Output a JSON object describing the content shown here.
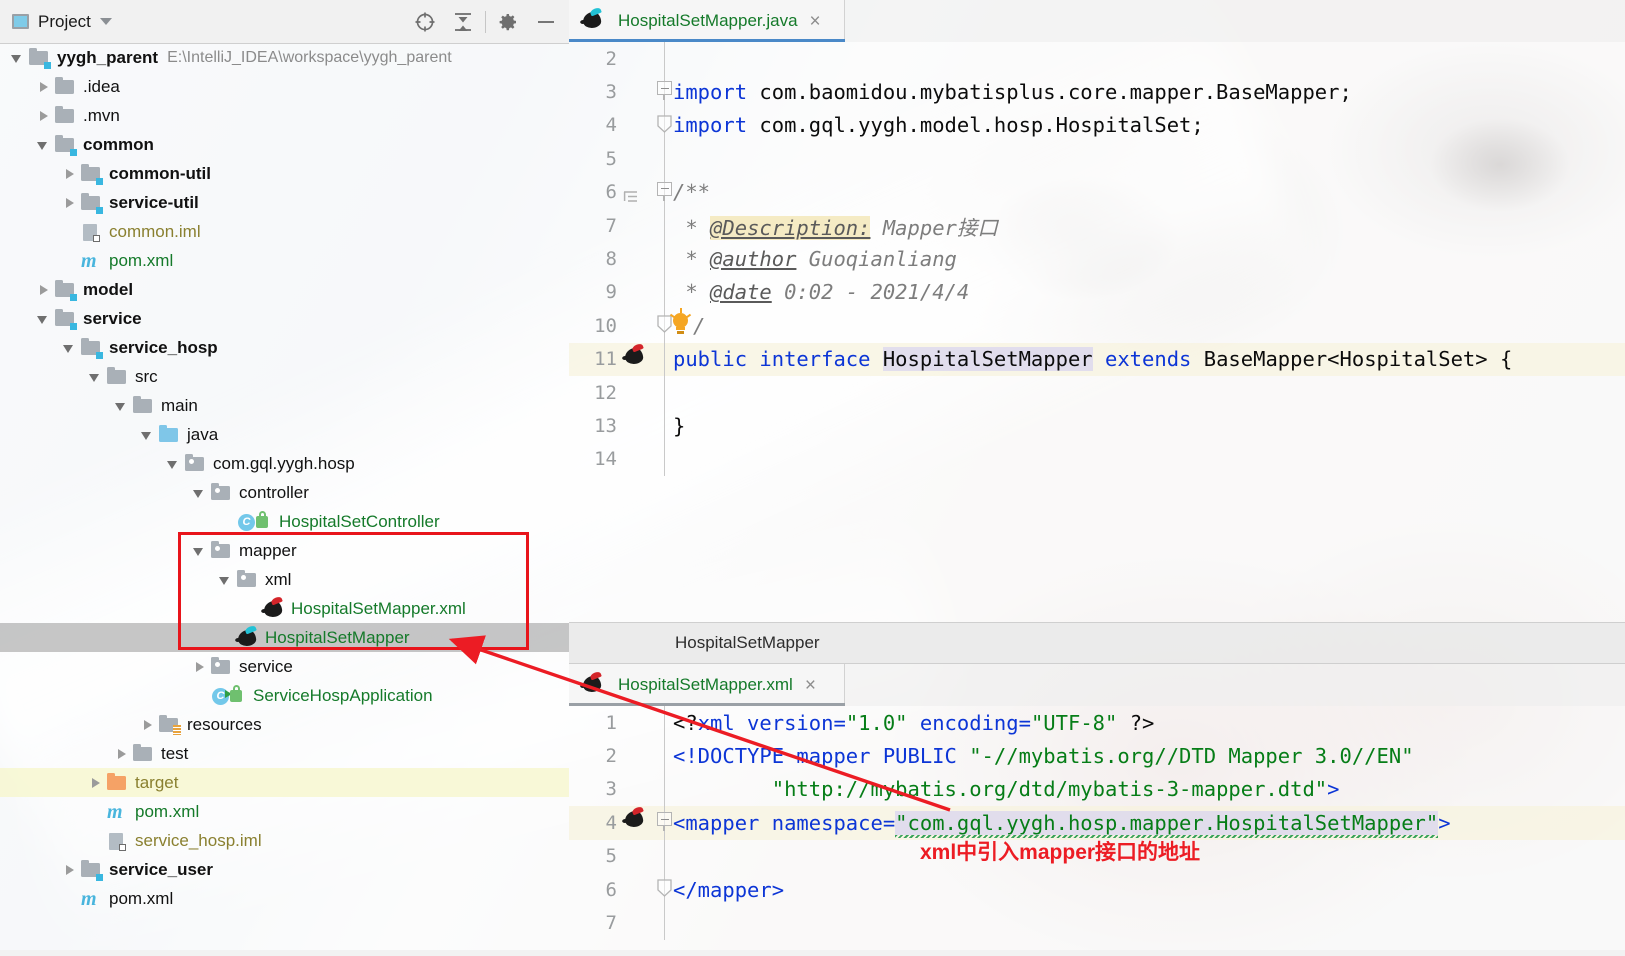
{
  "project_panel": {
    "title": "Project",
    "toolbar": [
      {
        "name": "locate-icon",
        "label": "Select Opened File"
      },
      {
        "name": "collapse-all-icon",
        "label": "Collapse All"
      },
      {
        "name": "gear-icon",
        "label": "Settings"
      },
      {
        "name": "minimize-icon",
        "label": "Hide"
      }
    ],
    "tree": [
      {
        "depth": 0,
        "arrow": "open",
        "icon": "module-folder",
        "label": "yygh_parent",
        "bold": true,
        "color": "dark",
        "sub": "E:\\IntelliJ_IDEA\\workspace\\yygh_parent"
      },
      {
        "depth": 1,
        "arrow": "closed",
        "icon": "folder-grey",
        "label": ".idea",
        "bold": false,
        "color": "dark"
      },
      {
        "depth": 1,
        "arrow": "closed",
        "icon": "folder-grey",
        "label": ".mvn",
        "bold": false,
        "color": "dark"
      },
      {
        "depth": 1,
        "arrow": "open",
        "icon": "module-folder",
        "label": "common",
        "bold": true,
        "color": "dark"
      },
      {
        "depth": 2,
        "arrow": "closed",
        "icon": "module-folder",
        "label": "common-util",
        "bold": true,
        "color": "dark"
      },
      {
        "depth": 2,
        "arrow": "closed",
        "icon": "module-folder",
        "label": "service-util",
        "bold": true,
        "color": "dark"
      },
      {
        "depth": 2,
        "arrow": "none",
        "icon": "iml-file",
        "label": "common.iml",
        "bold": false,
        "color": "olive"
      },
      {
        "depth": 2,
        "arrow": "none",
        "icon": "maven-file",
        "label": "pom.xml",
        "bold": false,
        "color": "green"
      },
      {
        "depth": 1,
        "arrow": "closed",
        "icon": "module-folder",
        "label": "model",
        "bold": true,
        "color": "dark"
      },
      {
        "depth": 1,
        "arrow": "open",
        "icon": "module-folder",
        "label": "service",
        "bold": true,
        "color": "dark"
      },
      {
        "depth": 2,
        "arrow": "open",
        "icon": "module-folder",
        "label": "service_hosp",
        "bold": true,
        "color": "dark"
      },
      {
        "depth": 3,
        "arrow": "open",
        "icon": "folder-grey",
        "label": "src",
        "bold": false,
        "color": "dark"
      },
      {
        "depth": 4,
        "arrow": "open",
        "icon": "folder-grey",
        "label": "main",
        "bold": false,
        "color": "dark"
      },
      {
        "depth": 5,
        "arrow": "open",
        "icon": "folder-blue",
        "label": "java",
        "bold": false,
        "color": "dark"
      },
      {
        "depth": 6,
        "arrow": "open",
        "icon": "package",
        "label": "com.gql.yygh.hosp",
        "bold": false,
        "color": "dark"
      },
      {
        "depth": 7,
        "arrow": "open",
        "icon": "package",
        "label": "controller",
        "bold": false,
        "color": "dark"
      },
      {
        "depth": 8,
        "arrow": "none",
        "icon": "java-class-lock",
        "label": "HospitalSetController",
        "bold": false,
        "color": "green"
      },
      {
        "depth": 7,
        "arrow": "open",
        "icon": "package",
        "label": "mapper",
        "bold": false,
        "color": "dark"
      },
      {
        "depth": 8,
        "arrow": "open",
        "icon": "package",
        "label": "xml",
        "bold": false,
        "color": "dark"
      },
      {
        "depth": 9,
        "arrow": "none",
        "icon": "mybatis-xml",
        "label": "HospitalSetMapper.xml",
        "bold": false,
        "color": "green"
      },
      {
        "depth": 8,
        "arrow": "none",
        "icon": "mybatis-iface",
        "label": "HospitalSetMapper",
        "bold": false,
        "color": "green",
        "selected": true
      },
      {
        "depth": 7,
        "arrow": "closed",
        "icon": "package",
        "label": "service",
        "bold": false,
        "color": "dark"
      },
      {
        "depth": 7,
        "arrow": "none",
        "icon": "spring-boot-class",
        "label": "ServiceHospApplication",
        "bold": false,
        "color": "green"
      },
      {
        "depth": 5,
        "arrow": "closed",
        "icon": "resources-folder",
        "label": "resources",
        "bold": false,
        "color": "dark"
      },
      {
        "depth": 4,
        "arrow": "closed",
        "icon": "folder-grey",
        "label": "test",
        "bold": false,
        "color": "dark"
      },
      {
        "depth": 3,
        "arrow": "closed",
        "icon": "folder-orange",
        "label": "target",
        "bold": false,
        "color": "olive",
        "highlight": true
      },
      {
        "depth": 3,
        "arrow": "none",
        "icon": "maven-file",
        "label": "pom.xml",
        "bold": false,
        "color": "green"
      },
      {
        "depth": 3,
        "arrow": "none",
        "icon": "iml-file",
        "label": "service_hosp.iml",
        "bold": false,
        "color": "olive"
      },
      {
        "depth": 2,
        "arrow": "closed",
        "icon": "module-folder",
        "label": "service_user",
        "bold": true,
        "color": "dark"
      },
      {
        "depth": 2,
        "arrow": "none",
        "icon": "maven-file",
        "label": "pom.xml",
        "bold": false,
        "color": "dark"
      }
    ]
  },
  "annotation": {
    "box_color": "#e8141b",
    "arrow_color": "#ec1c24",
    "note": "xml中引入mapper接口的地址"
  },
  "top_editor": {
    "tab": {
      "icon": "mybatis-iface-icon",
      "label": "HospitalSetMapper.java",
      "close": "×"
    },
    "lines": [
      {
        "num": "2",
        "segments": []
      },
      {
        "num": "3",
        "fold": "start",
        "segments": [
          {
            "t": "import ",
            "c": "kw"
          },
          {
            "t": "com.baomidou.mybatisplus.core.mapper.BaseMapper;",
            "c": "plain"
          }
        ]
      },
      {
        "num": "4",
        "fold": "end",
        "segments": [
          {
            "t": "import ",
            "c": "kw"
          },
          {
            "t": "com.gql.yygh.model.hosp.HospitalSet;",
            "c": "plain"
          }
        ]
      },
      {
        "num": "5",
        "segments": []
      },
      {
        "num": "6",
        "fold": "start",
        "indentguide": true,
        "segments": [
          {
            "t": "/**",
            "c": "cmt"
          }
        ]
      },
      {
        "num": "7",
        "segments": [
          {
            "t": " * ",
            "c": "cmt"
          },
          {
            "t": "@Description:",
            "c": "cmt-tag hl-doc"
          },
          {
            "t": " Mapper接口",
            "c": "cmt"
          }
        ]
      },
      {
        "num": "8",
        "segments": [
          {
            "t": " * ",
            "c": "cmt"
          },
          {
            "t": "@author",
            "c": "cmt-tag"
          },
          {
            "t": " Guoqianliang",
            "c": "cmt"
          }
        ]
      },
      {
        "num": "9",
        "segments": [
          {
            "t": " * ",
            "c": "cmt"
          },
          {
            "t": "@date",
            "c": "cmt-tag"
          },
          {
            "t": " 0:02 - 2021/4/4",
            "c": "cmt"
          }
        ]
      },
      {
        "num": "10",
        "fold": "end",
        "bulb": true,
        "segments": [
          {
            "t": "/",
            "c": "cmt"
          }
        ]
      },
      {
        "num": "11",
        "gutter_icon": "mybatis-bird",
        "highlight": true,
        "segments": [
          {
            "t": "public ",
            "c": "kw"
          },
          {
            "t": "interface ",
            "c": "kw"
          },
          {
            "t": "HospitalSetMapper",
            "c": "plain ident-hl"
          },
          {
            "t": " extends ",
            "c": "kw"
          },
          {
            "t": "BaseMapper<HospitalSet> {",
            "c": "plain"
          }
        ]
      },
      {
        "num": "12",
        "segments": []
      },
      {
        "num": "13",
        "segments": [
          {
            "t": "}",
            "c": "plain"
          }
        ]
      },
      {
        "num": "14",
        "segments": []
      }
    ]
  },
  "breadcrumb": {
    "label": "HospitalSetMapper"
  },
  "bottom_editor": {
    "tab": {
      "icon": "mybatis-xml-icon",
      "label": "HospitalSetMapper.xml",
      "close": "×"
    },
    "lines": [
      {
        "num": "1",
        "segments": [
          {
            "t": "<?",
            "c": "plain"
          },
          {
            "t": "xml",
            "c": "xtag"
          },
          {
            "t": " version=",
            "c": "xtag"
          },
          {
            "t": "\"1.0\"",
            "c": "str"
          },
          {
            "t": " encoding=",
            "c": "xtag"
          },
          {
            "t": "\"UTF-8\"",
            "c": "str"
          },
          {
            "t": " ?>",
            "c": "plain"
          }
        ]
      },
      {
        "num": "2",
        "segments": [
          {
            "t": "<!DOCTYPE mapper PUBLIC ",
            "c": "xtag"
          },
          {
            "t": "\"-//mybatis.org//DTD Mapper 3.0//EN\"",
            "c": "str"
          }
        ]
      },
      {
        "num": "3",
        "segments": [
          {
            "t": "        ",
            "c": "plain"
          },
          {
            "t": "\"http://mybatis.org/dtd/mybatis-3-mapper.dtd\"",
            "c": "str"
          },
          {
            "t": ">",
            "c": "xtag"
          }
        ]
      },
      {
        "num": "4",
        "gutter_icon": "mybatis-bird",
        "fold": "start",
        "highlight": true,
        "segments": [
          {
            "t": "<mapper",
            "c": "xtag"
          },
          {
            "t": " namespace=",
            "c": "xtag"
          },
          {
            "t": "\"com.gql.yygh.hosp.mapper.HospitalSetMapper\"",
            "c": "str ident-hl squiggle"
          },
          {
            "t": ">",
            "c": "xtag"
          }
        ]
      },
      {
        "num": "5",
        "segments": []
      },
      {
        "num": "6",
        "fold": "end",
        "segments": [
          {
            "t": "</mapper>",
            "c": "xtag"
          }
        ]
      },
      {
        "num": "7",
        "segments": []
      }
    ]
  }
}
